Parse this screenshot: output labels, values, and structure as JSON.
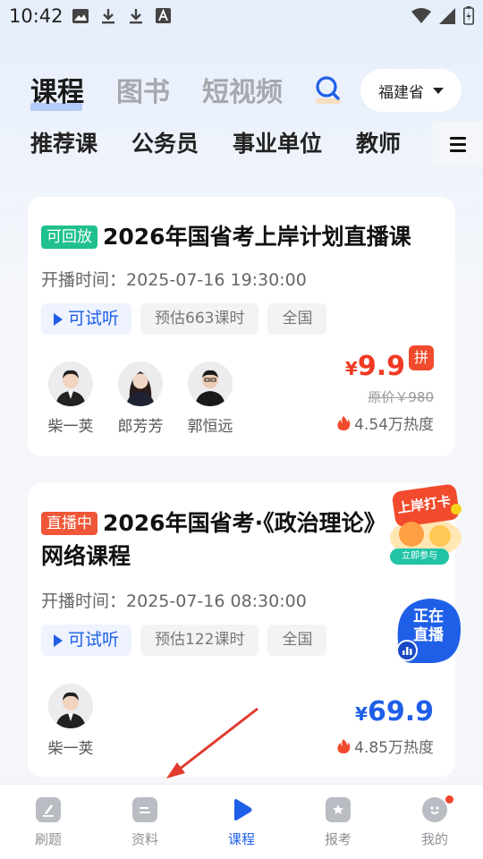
{
  "status_bar": {
    "time": "10:42"
  },
  "top_tabs": [
    {
      "label": "课程",
      "active": true
    },
    {
      "label": "图书",
      "active": false
    },
    {
      "label": "短视频",
      "active": false
    }
  ],
  "region": {
    "label": "福建省"
  },
  "categories": [
    "推荐课",
    "公务员",
    "事业单位",
    "教师"
  ],
  "cards": [
    {
      "badge": "可回放",
      "title": "2026年国省考上岸计划直播课",
      "time_label": "开播时间：",
      "time_value": "2025-07-16 19:30:00",
      "trial": "可试听",
      "hours": "预估663课时",
      "scope": "全国",
      "teachers": [
        "柴一荚",
        "郎芳芳",
        "郭恒远"
      ],
      "price_symbol": "¥",
      "price": "9.9",
      "group_badge": "拼",
      "original_price": "原价￥980",
      "heat": "4.54万热度"
    },
    {
      "badge": "直播中",
      "title": "2026年国省考·《政治理论》网络课程",
      "time_label": "开播时间：",
      "time_value": "2025-07-16 08:30:00",
      "trial": "可试听",
      "hours": "预估122课时",
      "scope": "全国",
      "teachers": [
        "柴一荚"
      ],
      "price_symbol": "¥",
      "price": "69.9",
      "heat": "4.85万热度"
    }
  ],
  "promo": {
    "title": "上岸打卡",
    "button": "立即参与"
  },
  "live_float": {
    "line1": "正在",
    "line2": "直播"
  },
  "bottom_nav": [
    {
      "label": "刷题",
      "active": false
    },
    {
      "label": "资料",
      "active": false
    },
    {
      "label": "课程",
      "active": true
    },
    {
      "label": "报考",
      "active": false
    },
    {
      "label": "我的",
      "active": false
    }
  ],
  "colors": {
    "accent": "#1f5fe8",
    "price_red": "#f03a23",
    "live_red": "#f05638",
    "replay_green": "#1fc08d"
  }
}
